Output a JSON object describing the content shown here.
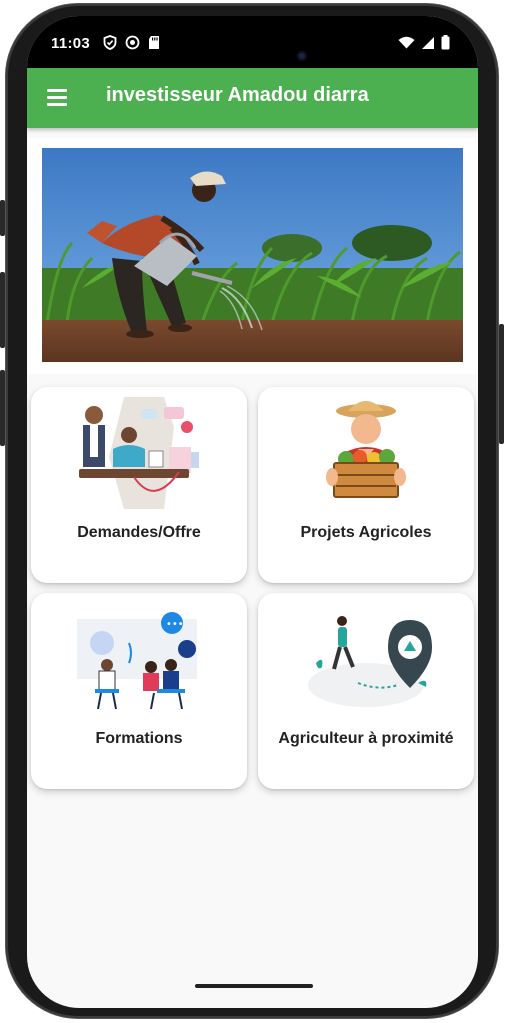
{
  "status_bar": {
    "time": "11:03"
  },
  "app_bar": {
    "title": "investisseur Amadou diarra"
  },
  "cards": [
    {
      "label": "Demandes/Offre"
    },
    {
      "label": "Projets Agricoles"
    },
    {
      "label": "Formations"
    },
    {
      "label": "Agriculteur à proximité"
    }
  ],
  "icons": [
    "menu-icon",
    "shield-icon",
    "circle-icon",
    "sdcard-icon",
    "wifi-icon",
    "signal-icon",
    "battery-icon"
  ],
  "colors": {
    "app_bar": "#4caf50",
    "background": "#f9f9f9",
    "card": "#ffffff",
    "text": "#222222"
  }
}
